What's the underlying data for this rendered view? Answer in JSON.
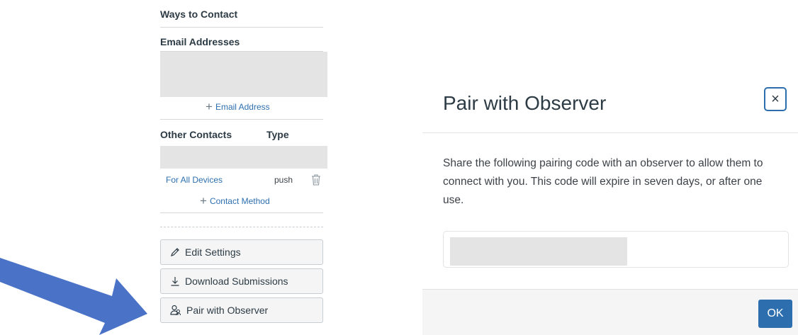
{
  "sidebar": {
    "ways_title": "Ways to Contact",
    "email_title": "Email Addresses",
    "add_email": "Email Address",
    "other_contacts_header": "Other Contacts",
    "type_header": "Type",
    "contact_row": {
      "name": "For All Devices",
      "type": "push"
    },
    "add_contact": "Contact Method",
    "buttons": {
      "edit_settings": "Edit Settings",
      "download_submissions": "Download Submissions",
      "pair_with_observer": "Pair with Observer"
    }
  },
  "modal": {
    "title": "Pair with Observer",
    "close_symbol": "×",
    "body": "Share the following pairing code with an observer to allow them to connect with you. This code will expire in seven days, or after one use.",
    "ok_label": "OK"
  },
  "colors": {
    "link": "#2d6fae",
    "arrow": "#4a72c7",
    "placeholder": "#e4e4e4",
    "primary": "#2d6fae"
  },
  "icons": {
    "add": "plus-icon",
    "trash": "trash-icon",
    "edit": "pencil-icon",
    "download": "download-icon",
    "pair": "observer-pair-icon",
    "close": "close-icon",
    "annotation": "arrow-pointer"
  }
}
